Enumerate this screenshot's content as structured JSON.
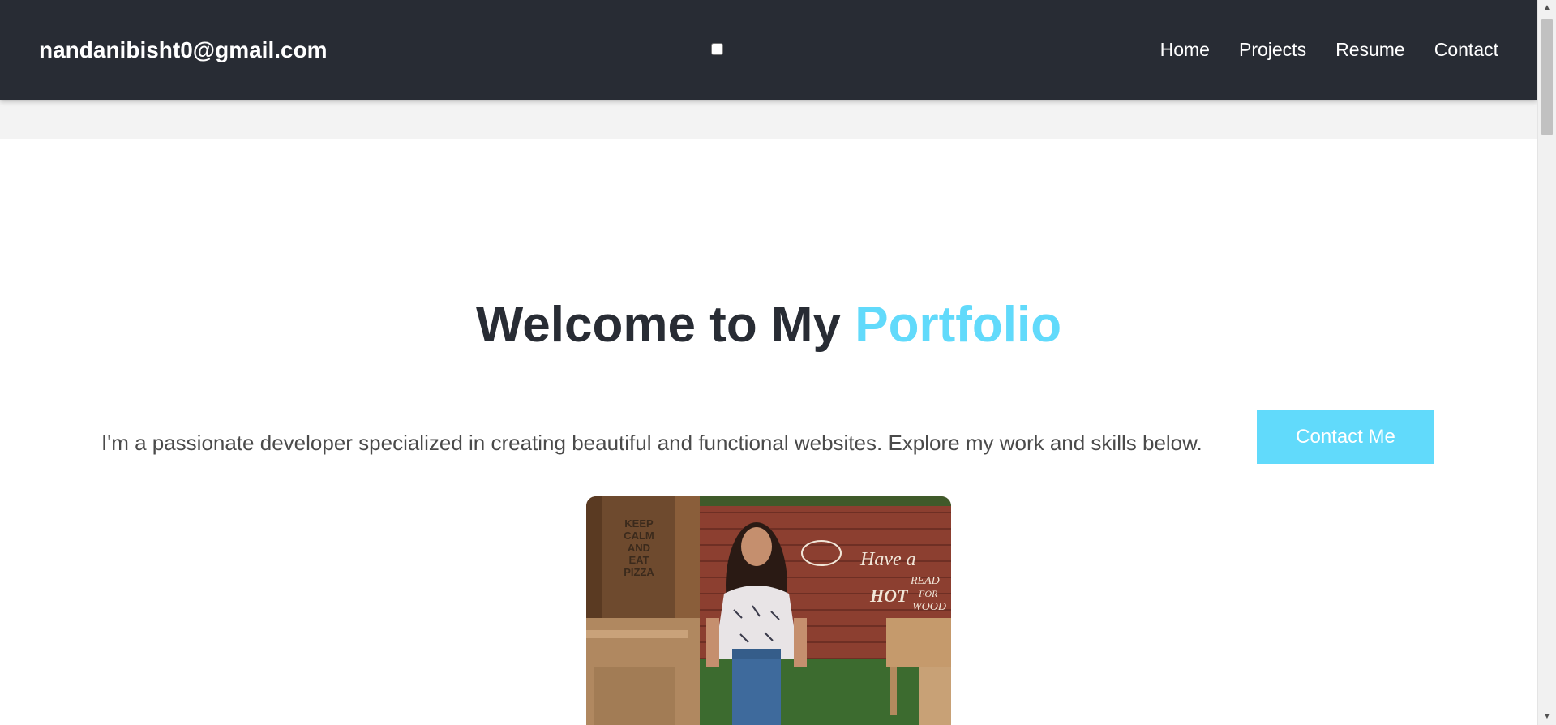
{
  "header": {
    "brand": "nandanibisht0@gmail.com",
    "nav": [
      {
        "label": "Home"
      },
      {
        "label": "Projects"
      },
      {
        "label": "Resume"
      },
      {
        "label": "Contact"
      }
    ]
  },
  "hero": {
    "title_main": "Welcome to My ",
    "title_accent": "Portfolio",
    "intro": "I'm a passionate developer specialized in creating beautiful and functional websites. Explore my work and skills below.",
    "cta_label": "Contact Me"
  },
  "photo": {
    "sign_lines": [
      "KEEP",
      "CALM",
      "AND",
      "EAT",
      "PIZZA"
    ],
    "wall_text": [
      "Have a",
      "HOT",
      "READ",
      "FOR",
      "WOOD"
    ]
  },
  "colors": {
    "navbar": "#282c34",
    "accent": "#61dafb",
    "title": "#282c34",
    "text": "#4a4a4a"
  },
  "icons": {
    "scroll_up": "triangle-up",
    "scroll_down": "triangle-down"
  }
}
